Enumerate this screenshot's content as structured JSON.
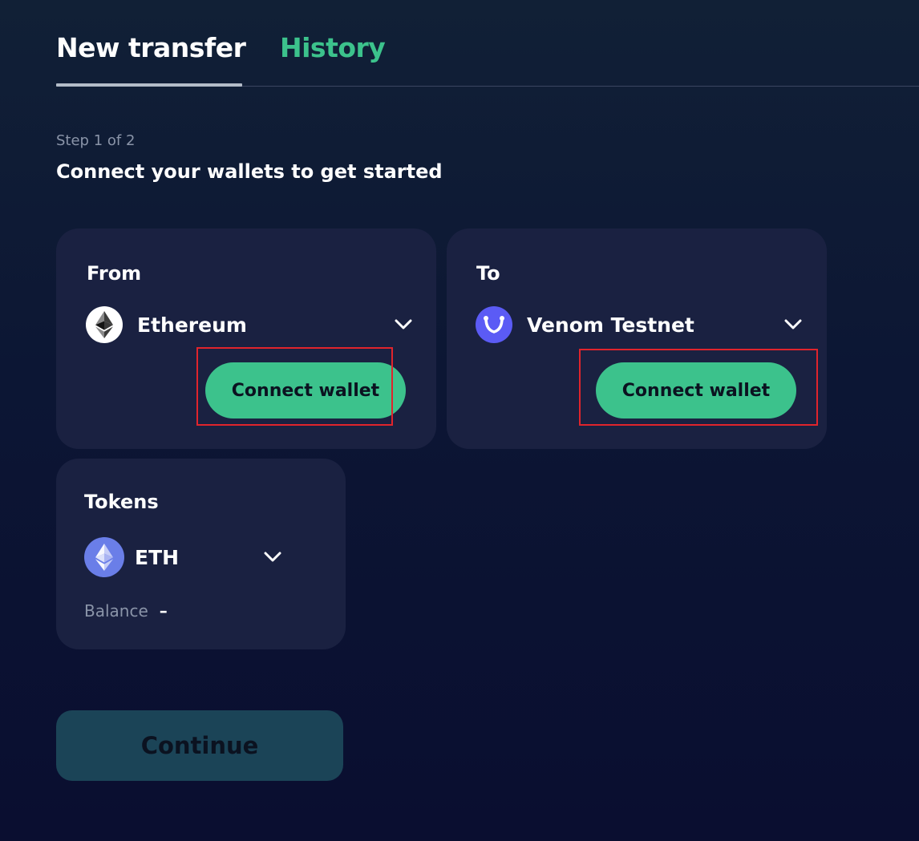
{
  "tabs": {
    "new_transfer": "New transfer",
    "history": "History",
    "active": "New transfer"
  },
  "step": {
    "label": "Step 1 of 2",
    "title": "Connect your wallets to get started"
  },
  "from_card": {
    "label": "From",
    "network": "Ethereum",
    "network_icon": "ethereum-icon",
    "connect_label": "Connect wallet",
    "highlighted": true
  },
  "to_card": {
    "label": "To",
    "network": "Venom Testnet",
    "network_icon": "venom-icon",
    "connect_label": "Connect wallet",
    "highlighted": true
  },
  "tokens_card": {
    "label": "Tokens",
    "token": "ETH",
    "token_icon": "eth-token-icon",
    "balance_label": "Balance",
    "balance_value": "–"
  },
  "continue_label": "Continue",
  "colors": {
    "accent": "#3cc28c",
    "card_bg": "#1a2141",
    "page_bg": "#0c1634",
    "highlight": "#e0242c",
    "continue_disabled_bg": "#1b4457",
    "venom": "#5b5bf5",
    "eth_token": "#6a7ee8"
  }
}
